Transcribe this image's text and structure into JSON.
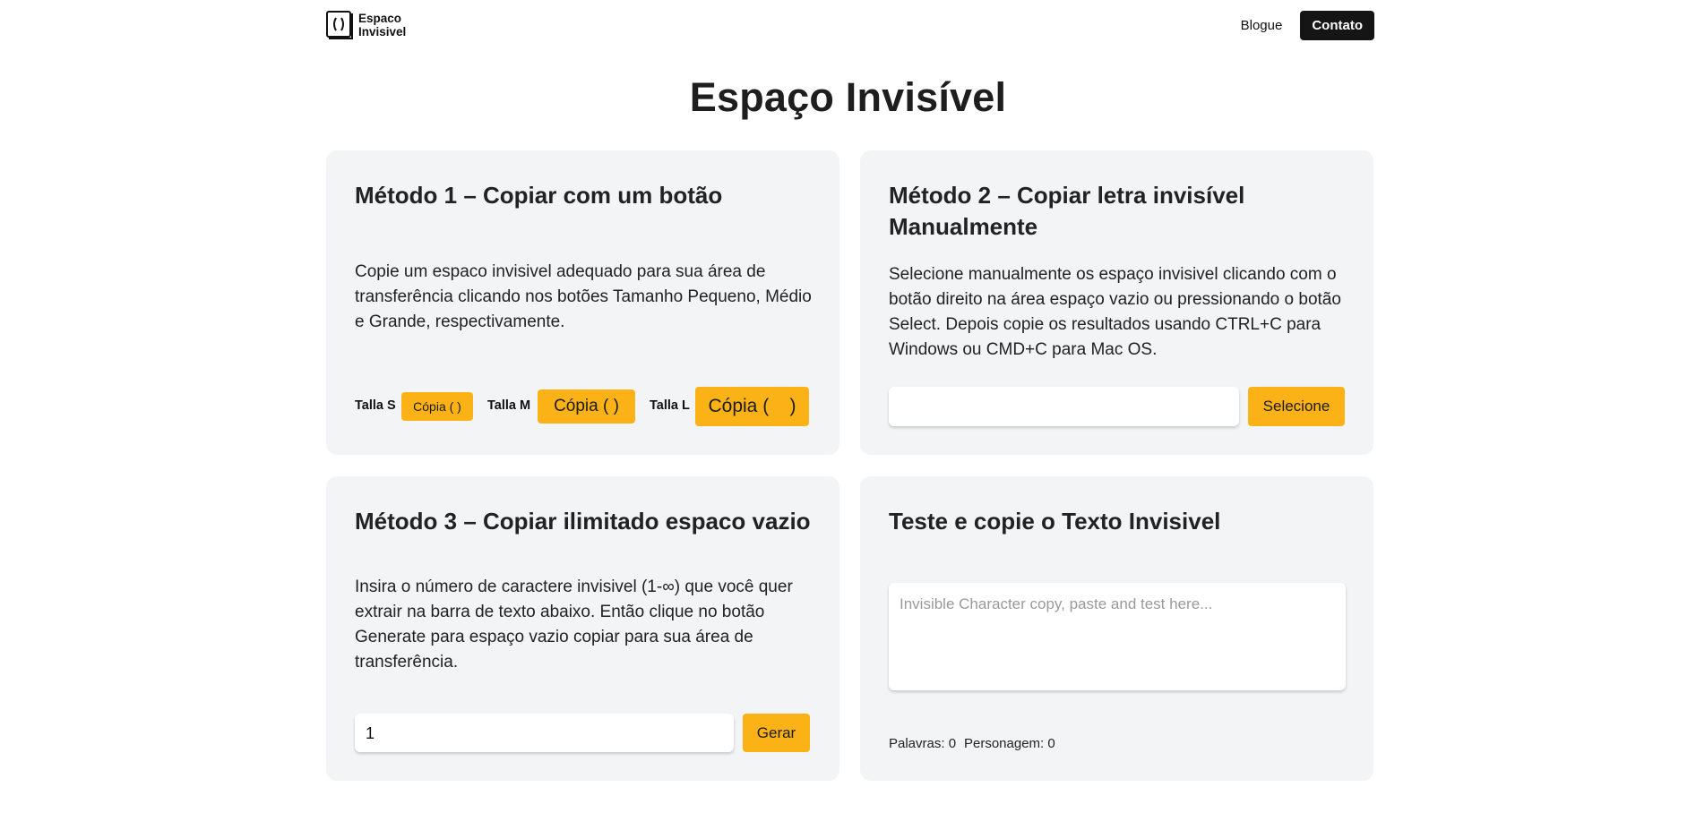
{
  "header": {
    "logo_line1": "Espaco",
    "logo_line2": "Invisivel",
    "nav_blog": "Blogue",
    "nav_contact": "Contato"
  },
  "page_title": "Espaço Invisível",
  "method1": {
    "title": "Método 1 – Copiar com um botão",
    "text": "Copie um espaco invisivel adequado para sua área de transferência clicando nos botões Tamanho Pequeno, Médio e Grande, respectivamente.",
    "size_s_label": "Talla S",
    "size_s_button": "Cópia ( )",
    "size_m_label": "Talla M",
    "size_m_button": "Cópia (  )",
    "size_l_label": "Talla L",
    "size_l_button": "Cópia (    )"
  },
  "method2": {
    "title": "Método 2 – Copiar letra invisível Manualmente",
    "text": "Selecione manualmente os espaço invisivel clicando com o botão direito na área espaço vazio ou pressionando o botão Select. Depois copie os resultados usando CTRL+C para Windows ou CMD+C para Mac OS.",
    "input_value": "",
    "select_button": "Selecione"
  },
  "method3": {
    "title": "Método 3 – Copiar ilimitado espaco vazio",
    "text": "Insira o número de caractere invisivel (1-∞) que você quer extrair na barra de texto abaixo. Então clique no botão Generate para espaço vazio copiar para sua área de transferência.",
    "input_value": "1",
    "generate_button": "Gerar"
  },
  "test": {
    "title": "Teste e copie o Texto Invisivel",
    "placeholder": "Invisible Character copy, paste and test here...",
    "words_label": "Palavras: 0",
    "chars_label": "Personagem: 0"
  }
}
